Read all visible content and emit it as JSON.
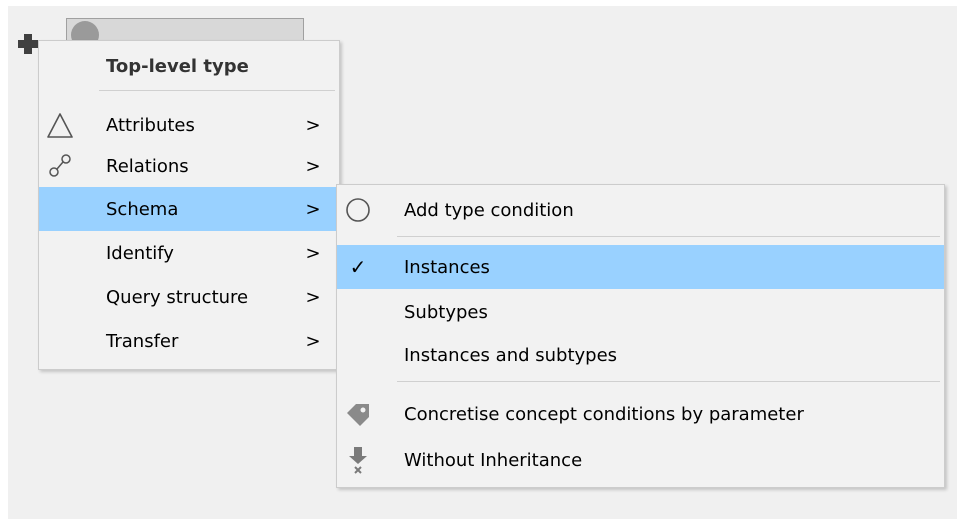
{
  "context_menu": {
    "header": "Top-level type",
    "items": [
      {
        "label": "Attributes",
        "arrow": ">"
      },
      {
        "label": "Relations",
        "arrow": ">"
      },
      {
        "label": "Schema",
        "arrow": ">"
      },
      {
        "label": "Identify",
        "arrow": ">"
      },
      {
        "label": "Query structure",
        "arrow": ">"
      },
      {
        "label": "Transfer",
        "arrow": ">"
      }
    ],
    "highlighted": "Schema"
  },
  "submenu": {
    "items": [
      {
        "label": "Add type condition",
        "icon": "circle-icon"
      },
      {
        "label": "Instances",
        "icon": "checkmark-icon",
        "checked": true,
        "check_glyph": "✓"
      },
      {
        "label": "Subtypes"
      },
      {
        "label": "Instances and subtypes"
      },
      {
        "label": "Concretise concept conditions by parameter",
        "icon": "tag-icon"
      },
      {
        "label": "Without Inheritance",
        "icon": "inheritance-off-icon"
      }
    ],
    "highlighted": "Instances"
  },
  "colors": {
    "menu_bg": "#f2f2f2",
    "highlight": "#99d1ff",
    "separator": "#d0d0d0"
  }
}
